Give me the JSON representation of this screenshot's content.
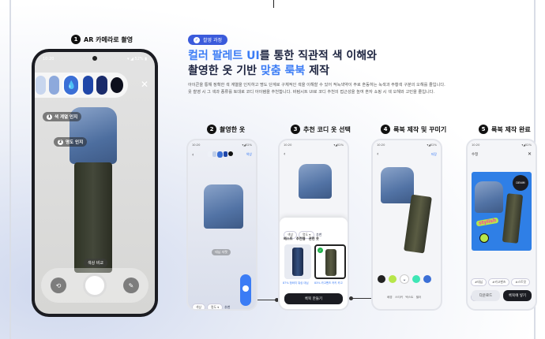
{
  "step1": {
    "num": "1",
    "label": "AR 카메라로 촬영"
  },
  "camera": {
    "time": "10:20",
    "signal": "▾ ◢ 52% ▮",
    "tag1": "색 계열 인지",
    "tag1_num": "1",
    "tag2": "명도 인지",
    "tag2_num": "2",
    "compare_label": "색상 비교"
  },
  "intro": {
    "badge_label": "촬영 과정",
    "headline_1a": "컬러 팔레트 UI",
    "headline_1b": "를 통한 직관적 색 이해와",
    "headline_2a": "촬영한 옷 기반 ",
    "headline_2b": "맞춤 룩북",
    "headline_2c": " 제작",
    "desc_1": "아이콘을 통해 정확한 색 계열을 인지하고 명도 단계로 구체적인 색을 이해할 수 있어 적녹색약이 주로 혼동하는 녹색과 주황색 구분의 오해를 줄입니다.",
    "desc_2": "옷 촬영 시 그 색과 종류를 토대로 코디 아이템을 추천합니다. 바텀시트 UI로 코디 추천의 접근성을 높여 혼자 쇼핑 시 색 오해와 고민을 줄입니다."
  },
  "step2": {
    "num": "2",
    "label": "촬영한 옷",
    "time": "10:20",
    "signal": "▾◢52%",
    "edit": "색상",
    "caption": "데님 자켓",
    "chip1": "색상",
    "chip2": "명도 ▾",
    "chip3": "추천"
  },
  "step3": {
    "num": "3",
    "label": "추천 코디 옷 선택",
    "time": "10:20",
    "signal": "▾◢52%",
    "chip1": "색상",
    "chip2": "명도 ▾",
    "chip3": "추천",
    "tabs": "베스트   추천템   관련 옷",
    "item1": "87% 청바지 워싱 데님",
    "item2": "83% 카고팬츠 카키 카고",
    "button": "룩북 만들기"
  },
  "step4": {
    "num": "4",
    "label": "룩북 제작 및 꾸미기",
    "time": "10:20",
    "signal": "▾◢52%",
    "edit": "저장",
    "toolbar": "배경   스티커   텍스트   필터"
  },
  "step5": {
    "num": "5",
    "label": "룩북 제작 완료",
    "time": "10:20",
    "signal": "▾◢52%",
    "title": "수정",
    "sticker1": "DENIM",
    "sticker2": "stylish",
    "chip1": "#데님",
    "chip2": "#카고팬츠",
    "chip3": "#스트릿",
    "chip4": "#겨울",
    "btn1": "다운로드",
    "btn2": "룩북에 넣기"
  },
  "colors": {
    "accent": "#3b7cf5",
    "badge": "#3b5bdb",
    "dark": "#1b1c22"
  },
  "icons": [
    "close-icon",
    "back-icon",
    "rotate-icon",
    "pen-icon",
    "drop-icon",
    "check-icon"
  ]
}
